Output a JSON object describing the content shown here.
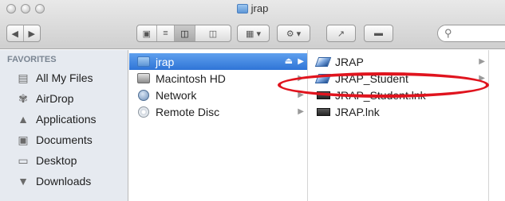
{
  "window": {
    "title": "jrap"
  },
  "toolbar": {
    "back_icon": "back-arrow",
    "forward_icon": "forward-arrow",
    "view_buttons": [
      "icon-view",
      "list-view",
      "column-view",
      "coverflow-view"
    ],
    "arrange_icon": "arrange-grid",
    "action_icon": "gear",
    "share_icon": "share",
    "tags_icon": "tag",
    "search_placeholder": ""
  },
  "sidebar": {
    "header": "FAVORITES",
    "items": [
      {
        "label": "All My Files",
        "icon": "all-files"
      },
      {
        "label": "AirDrop",
        "icon": "airdrop"
      },
      {
        "label": "Applications",
        "icon": "applications"
      },
      {
        "label": "Documents",
        "icon": "documents"
      },
      {
        "label": "Desktop",
        "icon": "desktop"
      },
      {
        "label": "Downloads",
        "icon": "downloads"
      }
    ]
  },
  "column1": {
    "items": [
      {
        "label": "jrap",
        "icon": "folder",
        "selected": true
      },
      {
        "label": "Macintosh HD",
        "icon": "hard-drive"
      },
      {
        "label": "Network",
        "icon": "network"
      },
      {
        "label": "Remote Disc",
        "icon": "disc"
      }
    ]
  },
  "column2": {
    "items": [
      {
        "label": "JRAP",
        "icon": "application"
      },
      {
        "label": "JRAP_Student",
        "icon": "application"
      },
      {
        "label": "JRAP_Student.lnk",
        "icon": "shortcut"
      },
      {
        "label": "JRAP.lnk",
        "icon": "shortcut"
      }
    ]
  },
  "annotation": {
    "color": "#e0141e"
  }
}
